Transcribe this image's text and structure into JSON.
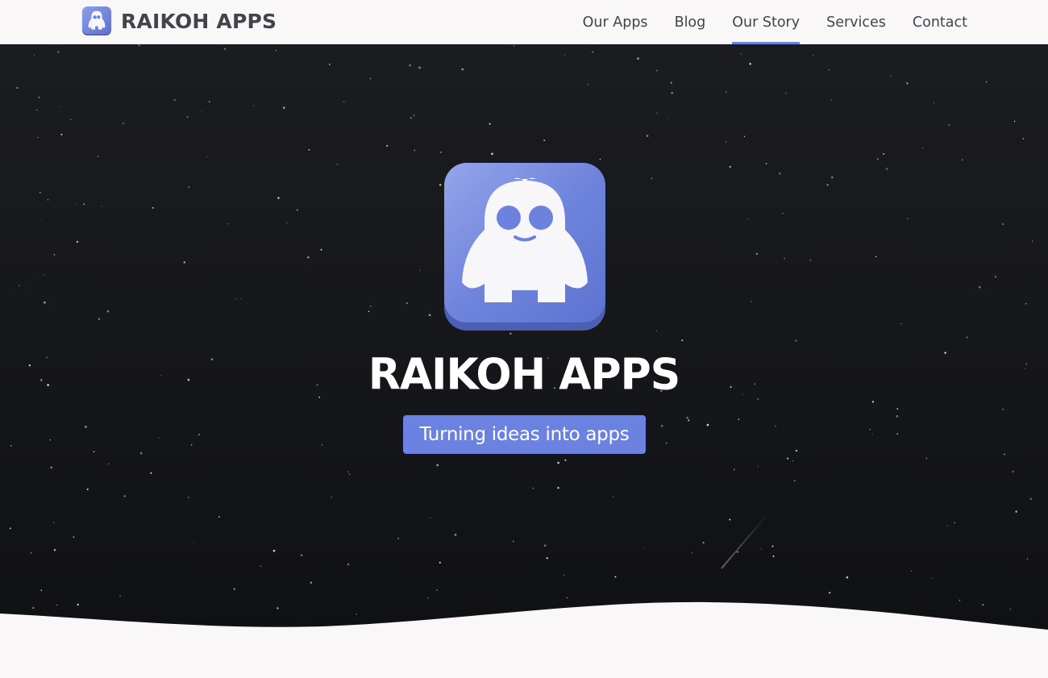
{
  "header": {
    "brand_name": "RAIKOH APPS",
    "logo_icon": "raikoh-ghost-logo-icon",
    "nav": [
      {
        "label": "Our Apps",
        "active": false
      },
      {
        "label": "Blog",
        "active": false
      },
      {
        "label": "Our Story",
        "active": true
      },
      {
        "label": "Services",
        "active": false
      },
      {
        "label": "Contact",
        "active": false
      }
    ]
  },
  "hero": {
    "title": "RAIKOH APPS",
    "tagline": "Turning ideas into apps",
    "logo_icon": "raikoh-ghost-logo-icon"
  },
  "colors": {
    "accent": "#6c82dc",
    "header_bg": "#f9f7f8",
    "hero_bg": "#17181c",
    "text_dark": "#414449"
  }
}
